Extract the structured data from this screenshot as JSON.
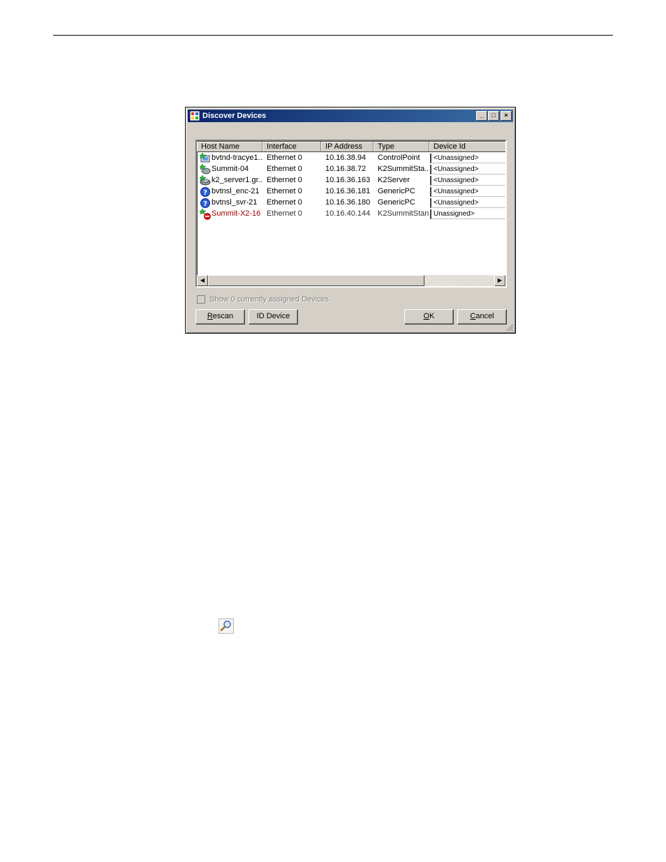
{
  "window": {
    "title": "Discover Devices",
    "minimize_glyph": "_",
    "maximize_glyph": "□",
    "close_glyph": "×"
  },
  "columns": [
    "Host Name",
    "Interface",
    "IP Address",
    "Type",
    "Device Id"
  ],
  "rows": [
    {
      "icon": "control-point-icon",
      "host": "bvtnd-tracye1...",
      "interface": "Ethernet 0",
      "ip": "10.16.38.94",
      "type": "ControlPoint",
      "device_id": "<Unassigned>"
    },
    {
      "icon": "k2-summit-icon",
      "host": "Summit-04",
      "interface": "Ethernet 0",
      "ip": "10.16.38.72",
      "type": "K2SummitSta...",
      "device_id": "<Unassigned>"
    },
    {
      "icon": "k2-server-icon",
      "host": "k2_server1.gr...",
      "interface": "Ethernet 0",
      "ip": "10.16.36.163",
      "type": "K2Server",
      "device_id": "<Unassigned>"
    },
    {
      "icon": "generic-pc-icon",
      "host": "bvtnsl_enc-21",
      "interface": "Ethernet 0",
      "ip": "10.16.36.181",
      "type": "GenericPC",
      "device_id": "<Unassigned>"
    },
    {
      "icon": "generic-pc-icon",
      "host": "bvtnsl_svr-21",
      "interface": "Ethernet 0",
      "ip": "10.16.36.180",
      "type": "GenericPC",
      "device_id": "<Unassigned>"
    },
    {
      "icon": "k2-summit-offline-icon",
      "host": "Summit-X2-16",
      "interface": "Ethernet 0",
      "ip": "10.16.40.144",
      "type": "K2SummitStan",
      "device_id": "Unassigned>"
    }
  ],
  "show_assigned": {
    "label": "Show 0 currently assigned Devices",
    "checked": false,
    "enabled": false
  },
  "buttons": {
    "rescan": "Rescan",
    "id_device": "ID Device",
    "ok": "OK",
    "cancel": "Cancel"
  },
  "scroll": {
    "left_arrow": "◀",
    "right_arrow": "▶"
  },
  "colors": {
    "titlebar_start": "#0a246a",
    "titlebar_end": "#3a6ea5",
    "dialog_face": "#d4d0c8",
    "offline_text": "#a00000"
  },
  "extra_icon": "magnifier-icon"
}
